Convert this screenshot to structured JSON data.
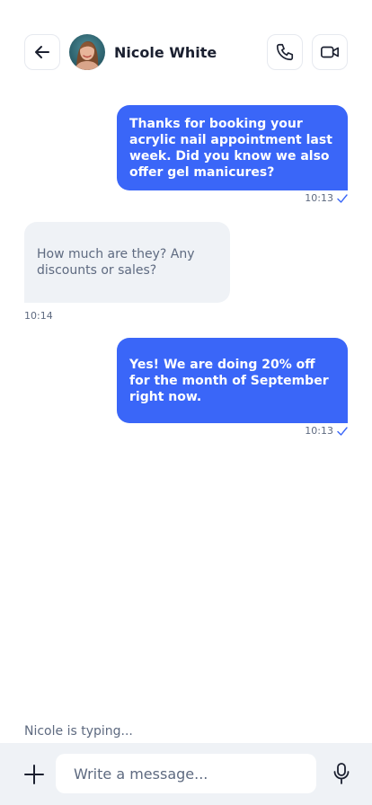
{
  "header": {
    "back_icon": "arrow-left-icon",
    "contact_name": "Nicole White",
    "call_icon": "phone-icon",
    "video_icon": "video-camera-icon"
  },
  "messages": [
    {
      "direction": "outgoing",
      "text": "Thanks for booking your acrylic nail appointment last week. Did you know we also offer gel manicures?",
      "time": "10:13",
      "read": true
    },
    {
      "direction": "incoming",
      "text": "How much are they? Any discounts or sales?",
      "time": "10:14"
    },
    {
      "direction": "outgoing",
      "text": "Yes! We are doing 20% off for the month of September right now.",
      "time": "10:13",
      "read": true
    }
  ],
  "status": {
    "typing_text": "Nicole is typing..."
  },
  "composer": {
    "add_icon": "plus-icon",
    "placeholder": "Write a message...",
    "value": "",
    "mic_icon": "microphone-icon"
  },
  "colors": {
    "accent": "#3a66f8",
    "incoming_bubble": "#eff2f6",
    "muted_text": "#5e6a80",
    "composer_bg": "#eff2f6"
  }
}
